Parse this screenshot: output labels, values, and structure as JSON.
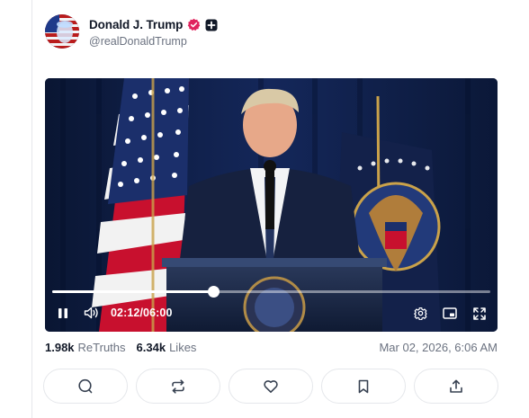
{
  "post": {
    "author_name": "Donald J. Trump",
    "author_handle": "@realDonaldTrump",
    "verified_color": "#e0245e"
  },
  "video": {
    "current_time": "02:12",
    "duration": "06:00",
    "time_display": "02:12/06:00",
    "progress_fraction": 0.367,
    "state": "playing"
  },
  "stats": {
    "retruths_count": "1.98k",
    "retruths_label": "ReTruths",
    "likes_count": "6.34k",
    "likes_label": "Likes",
    "timestamp": "Mar 02, 2026, 6:06 AM"
  },
  "actions": [
    {
      "icon": "reply-icon"
    },
    {
      "icon": "retruth-icon"
    },
    {
      "icon": "like-icon"
    },
    {
      "icon": "bookmark-icon"
    },
    {
      "icon": "share-icon"
    }
  ]
}
